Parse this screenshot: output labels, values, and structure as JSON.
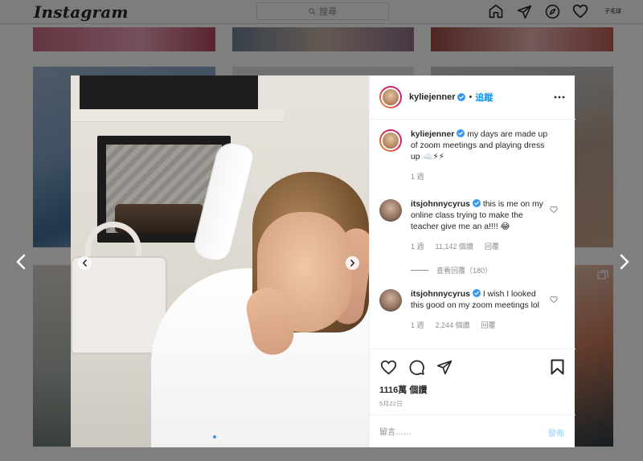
{
  "app": {
    "logo_text": "Instagram"
  },
  "header": {
    "search_placeholder": "搜尋",
    "profile_label": "子毛球"
  },
  "post": {
    "author": {
      "username": "kyliejenner",
      "verified": true,
      "follow_label": "追蹤",
      "separator": "•"
    },
    "caption": {
      "username": "kyliejenner",
      "text": "my days are made up of zoom meetings and playing dress up ☁️⚡⚡",
      "time": "1 週"
    },
    "comments": [
      {
        "username": "itsjohnnycyrus",
        "verified": true,
        "text": "this is me on my online class trying to make the teacher give me an a!!!! 😂",
        "time": "1 週",
        "likes": "11,142 個讚",
        "reply_label": "回覆"
      },
      {
        "username": "itsjohnnycyrus",
        "verified": true,
        "text": "I wish I looked this good on my zoom meetings lol",
        "time": "1 週",
        "likes": "2,244 個讚",
        "reply_label": "回覆"
      }
    ],
    "view_replies": "查看回覆（180）",
    "likes_count": "1116萬 個讚",
    "date": "5月22日",
    "add_comment_placeholder": "留言……",
    "post_label": "發佈",
    "carousel": {
      "total": 2,
      "active": 0
    }
  },
  "colors": {
    "accent": "#0095f6",
    "verified": "#3897f0",
    "post_disabled": "#b2dffc"
  },
  "icons": [
    "home-icon",
    "direct-icon",
    "explore-icon",
    "heart-icon",
    "search-icon",
    "more-icon",
    "like-icon",
    "comment-icon",
    "share-icon",
    "save-icon",
    "chevron-left-icon",
    "chevron-right-icon"
  ]
}
